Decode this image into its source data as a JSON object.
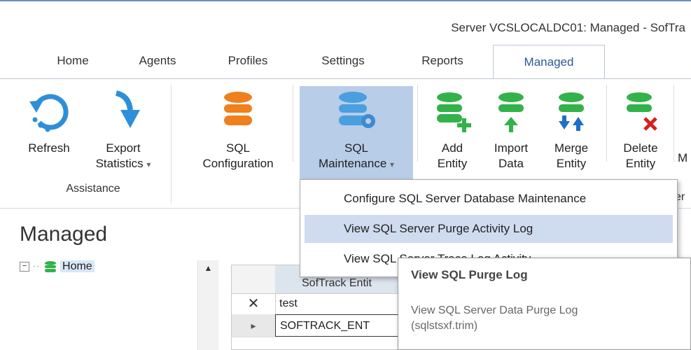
{
  "window": {
    "title": "Server VCSLOCALDC01: Managed - SofTra"
  },
  "tabs": [
    {
      "label": "Home"
    },
    {
      "label": "Agents"
    },
    {
      "label": "Profiles"
    },
    {
      "label": "Settings"
    },
    {
      "label": "Reports"
    },
    {
      "label": "Managed",
      "active": true
    }
  ],
  "ribbon": {
    "refresh": "Refresh",
    "export_line1": "Export",
    "export_line2": "Statistics",
    "group_assistance": "Assistance",
    "sqlconfig_line1": "SQL",
    "sqlconfig_line2": "Configuration",
    "sqlmaint_line1": "SQL",
    "sqlmaint_line2": "Maintenance",
    "add_line1": "Add",
    "add_line2": "Entity",
    "import_line1": "Import",
    "import_line2": "Data",
    "merge_line1": "Merge",
    "merge_line2": "Entity",
    "delete_line1": "Delete",
    "delete_line2": "Entity",
    "cut_label": "M",
    "cut_group": "er"
  },
  "dropdown_arrow": "▾",
  "menu": {
    "items": [
      {
        "label": "Configure SQL Server Database Maintenance"
      },
      {
        "label": "View SQL Server Purge Activity Log",
        "selected": true
      },
      {
        "label": "View SQL Server Trace Log Activity"
      }
    ]
  },
  "tooltip": {
    "title": "View SQL Purge Log",
    "desc_line1": "View SQL Server Data Purge Log",
    "desc_line2": "(sqlstsxf.trim)"
  },
  "left_panel": {
    "title": "Managed",
    "tree_root": "Home"
  },
  "grid": {
    "header": "SofTrack Entit",
    "rows": [
      {
        "marker": "✕",
        "value": "test"
      },
      {
        "marker": "▸",
        "value": "SOFTRACK_ENT"
      }
    ]
  },
  "colors": {
    "accent_blue": "#2b579a",
    "sql_orange": "#f07f1e",
    "entity_green": "#33b24a",
    "refresh_blue": "#2e8fd9",
    "delete_red": "#d62020"
  },
  "icons": {
    "refresh": "refresh-icon",
    "export": "export-arrow-icon",
    "sql_configuration": "database-orange-icon",
    "sql_maintenance": "database-gear-icon",
    "add_entity": "database-add-icon",
    "import_data": "database-import-icon",
    "merge_entity": "database-merge-icon",
    "delete_entity": "database-delete-icon",
    "tree_collapse": "tree-collapse-icon",
    "tree_db": "database-small-icon",
    "scroll_up": "scroll-up-icon"
  }
}
